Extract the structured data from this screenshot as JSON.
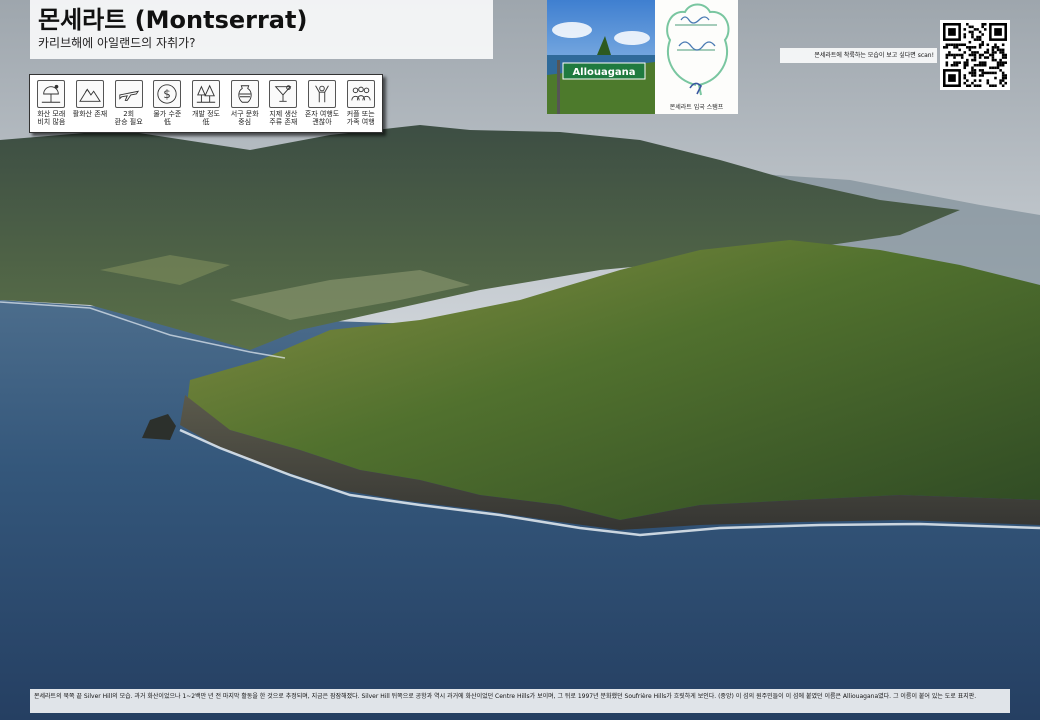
{
  "header": {
    "title": "몬세라트 (Montserrat)",
    "subtitle": "카리브해에 아일랜드의 자취가?"
  },
  "facts": [
    {
      "icon": "beach-umbrella-icon",
      "label": "화산 모래\n비치 많음"
    },
    {
      "icon": "mountain-icon",
      "label": "활화산 존재"
    },
    {
      "icon": "airplane-icon",
      "label": "2회\n환승 필요"
    },
    {
      "icon": "dollar-coin-icon",
      "label": "물가 수준\n低"
    },
    {
      "icon": "trees-icon",
      "label": "개발 정도\n低"
    },
    {
      "icon": "vase-icon",
      "label": "서구 문화\n중심"
    },
    {
      "icon": "cocktail-icon",
      "label": "지제 생산\n주류 존재"
    },
    {
      "icon": "people-cheer-icon",
      "label": "혼자 여행도\n괜찮아"
    },
    {
      "icon": "group-icon",
      "label": "커플 또는\n가족 여행"
    }
  ],
  "photos": {
    "road_sign_text": "Allouagana",
    "stamp_caption": "몬세라트 입국 스탬프"
  },
  "stamp_note": "몬세라트에 착륙하는 모습이 보고 싶다면 scan!",
  "caption": "몬세라트의 북쪽 끝 Silver Hill의 모습. 과거 화산이었으나 1~2백만 년 전 마지막 활동을 한 것으로 추정되며, 지금은 잠잠해졌다. Silver Hill 뒤쪽으로 공항과 역시 과거에 화산이었던 Centre Hills가 보이며, 그 뒤로 1997년 분화했던 Soufrière Hills가 흐릿하게 보인다. (중앙) 이 섬의 원주민들이 이 섬에 붙였던 이름은 Alliouagana였다. 그 이름이 붙어 있는 도로 표지판.",
  "colors": {
    "sea": "#2f5377",
    "land_green": "#4f6b31",
    "sky": "#c8cfd6"
  }
}
